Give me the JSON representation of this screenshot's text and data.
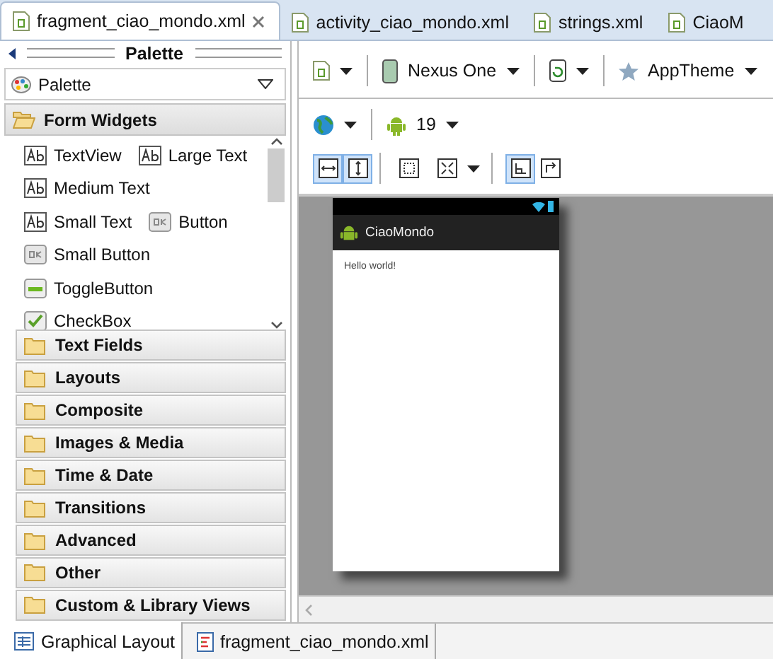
{
  "editor_tabs": [
    {
      "label": "fragment_ciao_mondo.xml",
      "selected": true
    },
    {
      "label": "activity_ciao_mondo.xml",
      "selected": false
    },
    {
      "label": "strings.xml",
      "selected": false
    },
    {
      "label": "CiaoM",
      "selected": false
    }
  ],
  "palette": {
    "title": "Palette",
    "dropdown": "Palette",
    "categories": [
      {
        "label": "Form Widgets",
        "expanded": true,
        "widgets": [
          [
            {
              "label": "TextView",
              "kind": "text"
            },
            {
              "label": "Large Text",
              "kind": "text"
            }
          ],
          [
            {
              "label": "Medium Text",
              "kind": "text"
            }
          ],
          [
            {
              "label": "Small Text",
              "kind": "text"
            },
            {
              "label": "Button",
              "kind": "ok"
            }
          ],
          [
            {
              "label": "Small Button",
              "kind": "ok"
            }
          ],
          [
            {
              "label": "ToggleButton",
              "kind": "toggle"
            }
          ],
          [
            {
              "label": "CheckBox",
              "kind": "check"
            }
          ]
        ]
      },
      {
        "label": "Text Fields",
        "expanded": false
      },
      {
        "label": "Layouts",
        "expanded": false
      },
      {
        "label": "Composite",
        "expanded": false
      },
      {
        "label": "Images & Media",
        "expanded": false
      },
      {
        "label": "Time & Date",
        "expanded": false
      },
      {
        "label": "Transitions",
        "expanded": false
      },
      {
        "label": "Advanced",
        "expanded": false
      },
      {
        "label": "Other",
        "expanded": false
      },
      {
        "label": "Custom & Library Views",
        "expanded": false
      }
    ]
  },
  "toolbar": {
    "device": "Nexus One",
    "theme": "AppTheme",
    "api_level": "19",
    "view_buttons": [
      {
        "kind": "fill-width",
        "selected": true
      },
      {
        "kind": "fill-height",
        "selected": true
      },
      {
        "kind": "outline",
        "selected": false
      },
      {
        "kind": "zoom",
        "selected": false
      },
      {
        "kind": "emulate",
        "selected": true
      },
      {
        "kind": "clip",
        "selected": false
      }
    ]
  },
  "preview": {
    "app_title": "CiaoMondo",
    "content_text": "Hello world!"
  },
  "bottom_tabs": [
    {
      "label": "Graphical Layout",
      "selected": true
    },
    {
      "label": "fragment_ciao_mondo.xml",
      "selected": false
    }
  ]
}
